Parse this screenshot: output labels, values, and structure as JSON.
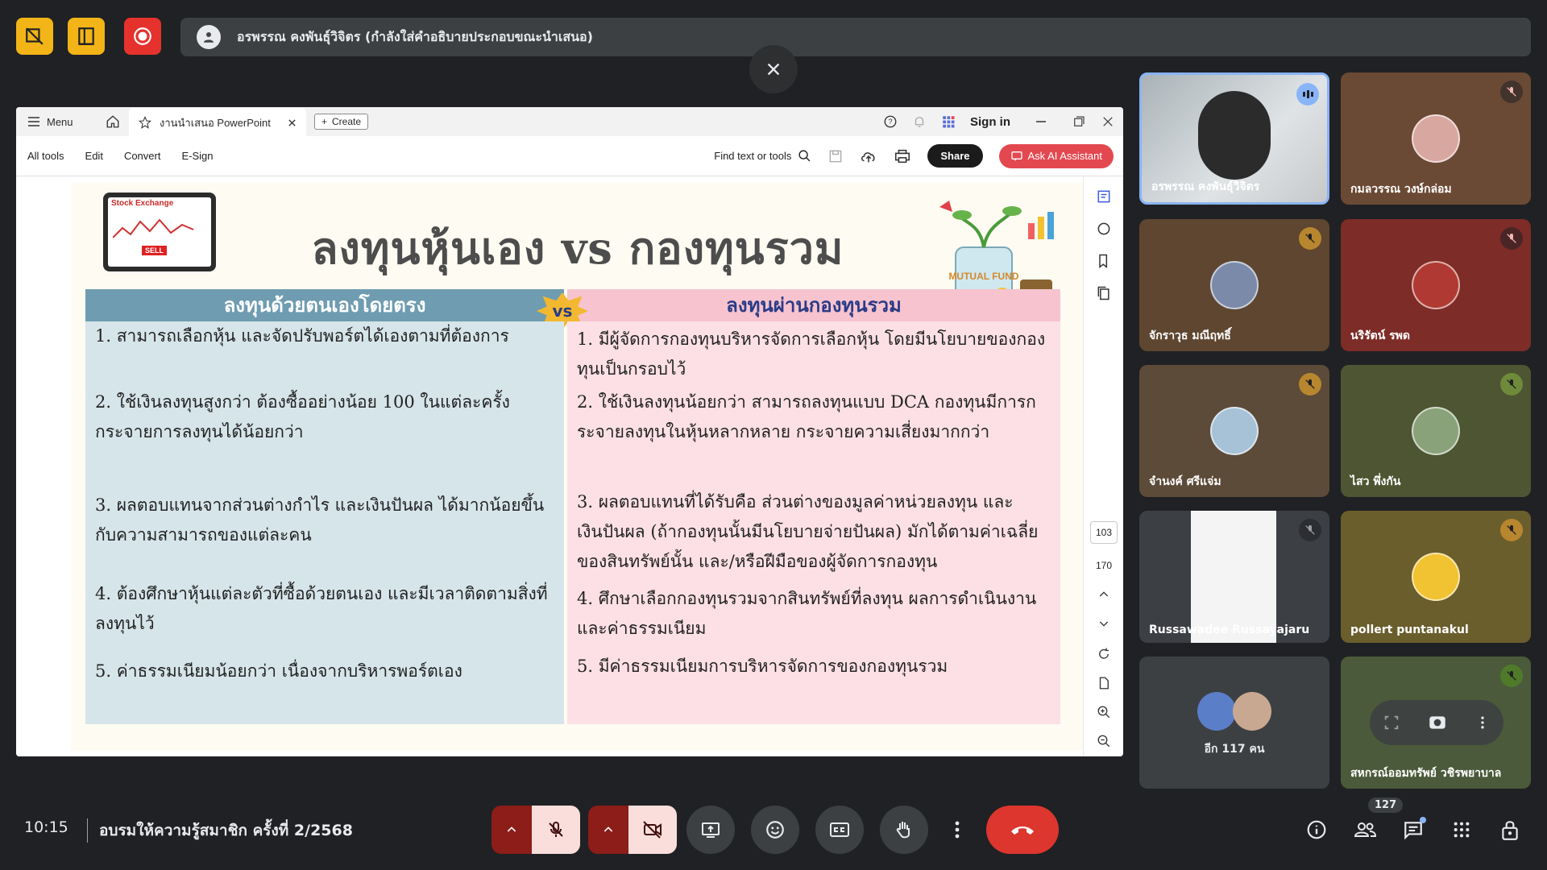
{
  "presenter_banner": "อรพรรณ คงพันธุ์วิจิตร (กำลังใส่คำอธิบายประกอบขณะนำเสนอ)",
  "browser": {
    "menu_label": "Menu",
    "tab_label": "งานนำเสนอ PowerPoint",
    "create_label": "Create",
    "sign_in": "Sign in"
  },
  "toolbar": {
    "all_tools": "All tools",
    "edit": "Edit",
    "convert": "Convert",
    "esign": "E-Sign",
    "find": "Find text or tools",
    "share": "Share",
    "ai": "Ask AI Assistant"
  },
  "slide": {
    "tablet_label": "Stock Exchange",
    "sell_label": "SELL",
    "title": "ลงทุนหุ้นเอง vs กองทุนรวม",
    "vs": "vs",
    "fund_label": "MUTUAL FUND",
    "left_header": "ลงทุนด้วยตนเองโดยตรง",
    "right_header": "ลงทุนผ่านกองทุนรวม",
    "left_points": [
      "1. สามารถเลือกหุ้น และจัดปรับพอร์ตได้เองตามที่ต้องการ",
      "2. ใช้เงินลงทุนสูงกว่า ต้องซื้ออย่างน้อย 100 ในแต่ละครั้ง กระจายการลงทุนได้น้อยกว่า",
      "3. ผลตอบแทนจากส่วนต่างกำไร และเงินปันผล ได้มากน้อยขึ้นกับความสามารถของแต่ละคน",
      "4. ต้องศึกษาหุ้นแต่ละตัวที่ซื้อด้วยตนเอง และมีเวลาติดตามสิ่งที่ลงทุนไว้",
      "5. ค่าธรรมเนียมน้อยกว่า เนื่องจากบริหารพอร์ตเอง"
    ],
    "right_points": [
      "1. มีผู้จัดการกองทุนบริหารจัดการเลือกหุ้น โดยมีนโยบายของกองทุนเป็นกรอบไว้",
      "2. ใช้เงินลงทุนน้อยกว่า สามารถลงทุนแบบ DCA กองทุนมีการกระจายลงทุนในหุ้นหลากหลาย กระจายความเสี่ยงมากกว่า",
      "3. ผลตอบแทนที่ได้รับคือ ส่วนต่างของมูลค่าหน่วยลงทุน และเงินปันผล (ถ้ากองทุนนั้นมีนโยบายจ่ายปันผล) มักได้ตามค่าเฉลี่ยของสินทรัพย์นั้น และ/หรือฝีมือของผู้จัดการกองทุน",
      "4. ศึกษาเลือกกองทุนรวมจากสินทรัพย์ที่ลงทุน ผลการดำเนินงาน และค่าธรรมเนียม",
      "5. มีค่าธรรมเนียมการบริหารจัดการของกองทุนรวม"
    ]
  },
  "pages": {
    "current": "103",
    "total": "170"
  },
  "participants": [
    {
      "name": "อรพรรณ คงพันธุ์วิจิตร",
      "speaking": true
    },
    {
      "name": "กมลวรรณ วงษ์กล่อม",
      "muted": true
    },
    {
      "name": "จักราวุธ มณีฤทธิ์",
      "muted": true
    },
    {
      "name": "นริรัตน์ รพด",
      "muted": true
    },
    {
      "name": "จำนงค์ ศรีแจ่ม",
      "muted": true
    },
    {
      "name": "ไสว พึ่งกัน",
      "muted": true
    },
    {
      "name": "Russawadee Russayajaru",
      "muted": true
    },
    {
      "name": "pollert puntanakul",
      "muted": true
    },
    {
      "name": "อีก 117 คน"
    },
    {
      "name": "สหกรณ์ออมทรัพย์ วชิรพยาบาล",
      "muted": true
    }
  ],
  "bottom": {
    "time": "10:15",
    "meeting_title": "อบรมให้ความรู้สมาชิก ครั้งที่ 2/2568",
    "people_count": "127"
  },
  "colors": {
    "accent_yellow": "#f2b416",
    "record_red": "#e5322d",
    "end_call": "#dc362e",
    "left_header": "#6f9cb1",
    "right_header": "#f6c3cf"
  }
}
